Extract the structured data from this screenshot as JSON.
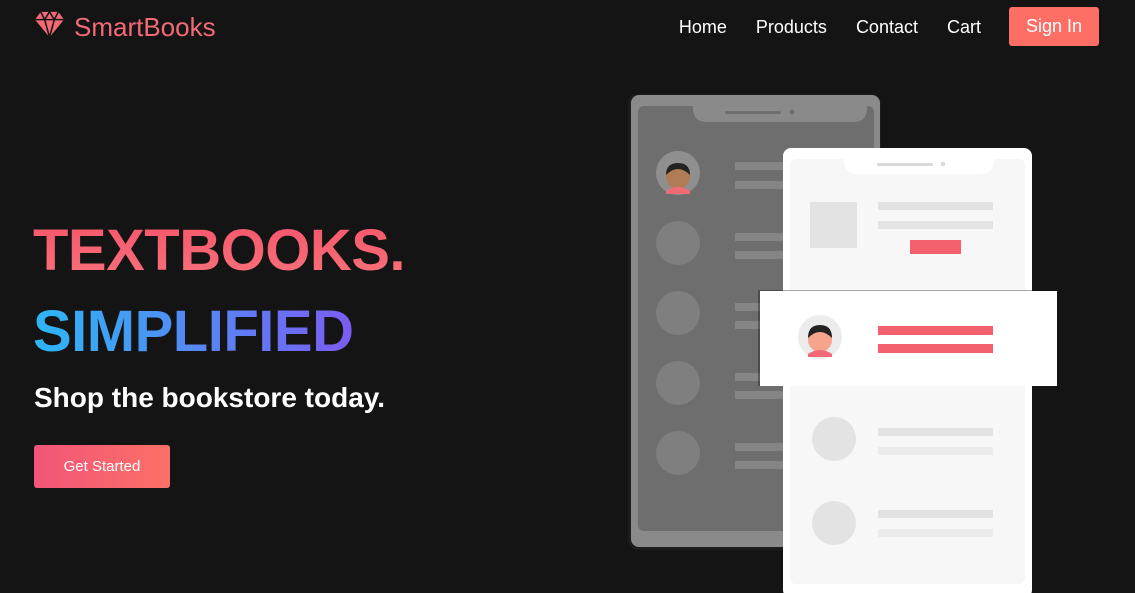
{
  "brand": {
    "name": "SmartBooks",
    "icon": "diamond-icon",
    "color": "#f36a77"
  },
  "nav": {
    "links": [
      "Home",
      "Products",
      "Contact",
      "Cart"
    ],
    "signin_label": "Sign In",
    "signin_color": "#fd6f64"
  },
  "hero": {
    "title_line1": "TEXTBOOKS.",
    "title_line2": "SIMPLIFIED",
    "tagline": "Shop the bookstore today.",
    "cta_label": "Get Started"
  },
  "illustration": {
    "icon": "phone-list-illustration",
    "accent": "#f3606e"
  }
}
